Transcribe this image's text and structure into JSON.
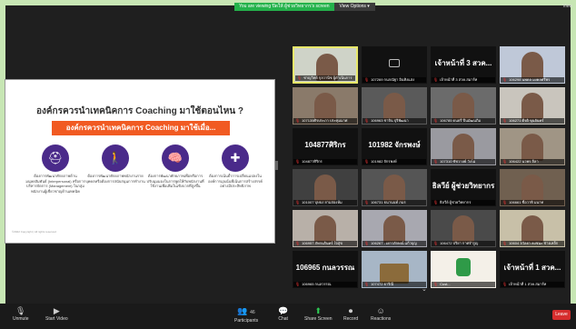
{
  "banner": {
    "viewing_text": "You are viewing ปิดให้ ผู้ช่วยวิทยากร's screen",
    "view_options_label": "View Options ▾"
  },
  "view_button": "View",
  "slide": {
    "title": "องค์กรควรนำเทคนิคการ Coaching มาใช้ตอนไหน ?",
    "subtitle": "องค์กรควรนำเทคนิคการ Coaching มาใช้เมื่อ...",
    "circles": [
      {
        "icon": "⛑",
        "icon_name": "worker-helmet-icon",
        "desc": "ต้องการพัฒนาศักยภาพด้านมนุษยสัมพันธ์ (Interpersonal) หรือการบริหารจัดการ (Management) ในกลุ่มพนักงานผู้เชี่ยวชาญด้านเทคนิค"
      },
      {
        "icon": "🚶",
        "icon_name": "walking-person-icon",
        "desc": "ต้องการพัฒนาศักยภาพพนักงานรายบุคคลหรือต้องการสนับสนุนการทำงาน"
      },
      {
        "icon": "🧠",
        "icon_name": "brain-icon",
        "desc": "ต้องการพัฒนาศักยภาพเพื่อหรือการปรับมุมมองในการพูดให้กับพนักงานที่ใช้งานเพื่อเพิ่มในเชิงบวกที่สูงขึ้น"
      },
      {
        "icon": "✚",
        "icon_name": "puzzle-icon",
        "desc": "ต้องการเน้นย้ำการเปลี่ยนแปลงในองค์การมุ่งเน้นที่เน้นการสร้างสรรค์อย่างมีประสิทธิภาพ"
      }
    ],
    "copyright": "©2022 Copyright | All rights reserved"
  },
  "tiles": [
    {
      "big": "",
      "cap": "ชาญวิทย์ กุลวานิช ผู้ดำเนินการ",
      "style": "person",
      "color": "#cfd3c8"
    },
    {
      "big": "",
      "cap": "107269 กนกณัฐา อินทิงแสง",
      "style": "camera-off",
      "color": "#111"
    },
    {
      "big": "เจ้าหน้าที่ 3 สวค...",
      "cap": "เจ้าหน้าที่ 3 สวค.สมาร์ท",
      "style": "name",
      "color": "#111"
    },
    {
      "big": "",
      "cap": "106298 นพดล มงคลศรีพร",
      "style": "person",
      "color": "#bfc8d8"
    },
    {
      "big": "",
      "cap": "107135ศิรประภา ประทุมมาศ",
      "style": "person",
      "color": "#8a7a6a"
    },
    {
      "big": "",
      "cap": "106963 ชาจิน ปุริพัฒนา",
      "style": "person",
      "color": "#5a5a5a"
    },
    {
      "big": "",
      "cap": "106785 ดนธรี ปิ่นมัฒนภิม",
      "style": "person",
      "color": "#6b6b6b"
    },
    {
      "big": "",
      "cap": "106271 ดีรติ ขุนจันทร์",
      "style": "person",
      "color": "#c9c5bd"
    },
    {
      "big": "104877ศิริกร",
      "cap": "104877ศิริกร",
      "style": "name",
      "color": "#111"
    },
    {
      "big": "101982 จักรพงษ์",
      "cap": "101982 จักรพงษ์",
      "style": "name",
      "color": "#111"
    },
    {
      "big": "",
      "cap": "107310 ชัชวาลย์ วังโม",
      "style": "person",
      "color": "#9a9aa0"
    },
    {
      "big": "",
      "cap": "106422 นวพร ลีลา",
      "style": "person",
      "color": "#a09585"
    },
    {
      "big": "",
      "cap": "101007 บุษบง ยามสองห้ม",
      "style": "person",
      "color": "#404040"
    },
    {
      "big": "",
      "cap": "106731 ธนานนท์ ภมร",
      "style": "person",
      "color": "#555"
    },
    {
      "big": "ธิลวีย์ ผู้ช่วยวิทยากร",
      "cap": "ธิลวีย์ ผู้ช่วยวิทยากร",
      "style": "name",
      "color": "#111"
    },
    {
      "big": "",
      "cap": "106661 ชื่อวาทิ มนาท",
      "style": "person",
      "color": "#706050"
    },
    {
      "big": "",
      "cap": "106957 ภัทรนรินทร์ ใจสุข",
      "style": "person",
      "color": "#b8b0a8"
    },
    {
      "big": "",
      "cap": "106267 - เยาวลักษณ์ แก้วบุญ",
      "style": "person",
      "color": "#a8a8b0"
    },
    {
      "big": "",
      "cap": "106472 ปริยา กาศจำรูญ",
      "style": "person",
      "color": "#4a4a4a"
    },
    {
      "big": "",
      "cap": "10604 ลวัลยา คงชนะ ช่างเหล็ก",
      "style": "person",
      "color": "#c8c0a8"
    },
    {
      "big": "106965 กนลวรรณ",
      "cap": "106965 กนลวรรณ",
      "style": "name",
      "color": "#111"
    },
    {
      "big": "",
      "cap": "107472 ธาริณี",
      "style": "temple",
      "color": "#a7b6c6"
    },
    {
      "big": "",
      "cap": "Cust...",
      "style": "logo",
      "color": "#f4f0e8"
    },
    {
      "big": "เจ้าหน้าที่ 1 สวค...",
      "cap": "เจ้าหน้าที่ 1 สวค.สมาร์ท",
      "style": "name",
      "color": "#111"
    }
  ],
  "pager": "⌄",
  "toolbar": {
    "unmute": "Unmute",
    "start_video": "Start Video",
    "participants": "Participants",
    "participants_count": "46",
    "chat": "Chat",
    "share_screen": "Share Screen",
    "record": "Record",
    "reactions": "Reactions",
    "leave": "Leave"
  }
}
